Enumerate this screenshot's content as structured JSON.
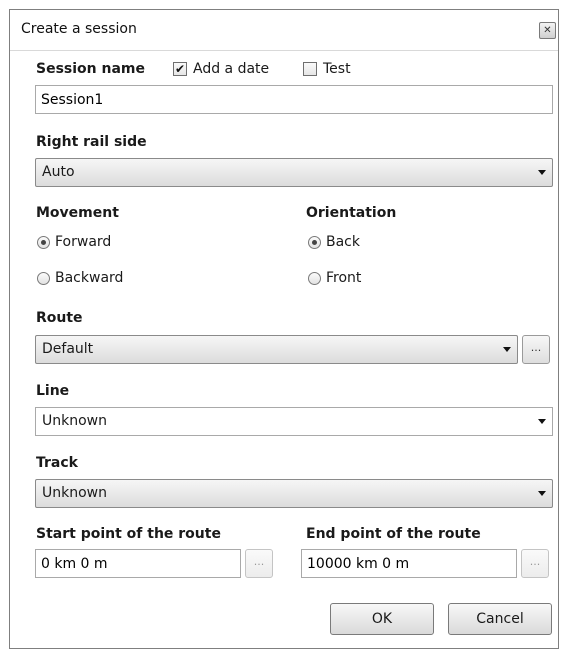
{
  "window": {
    "title": "Create a session",
    "close_glyph": "✕"
  },
  "session": {
    "label": "Session name",
    "add_date_label": "Add a date",
    "add_date_checked": true,
    "test_label": "Test",
    "test_checked": false,
    "name_value": "Session1"
  },
  "rail": {
    "label": "Right rail side",
    "value": "Auto"
  },
  "movement": {
    "label": "Movement",
    "forward": "Forward",
    "backward": "Backward",
    "selected": "Forward"
  },
  "orientation": {
    "label": "Orientation",
    "back": "Back",
    "front": "Front",
    "selected": "Back"
  },
  "route": {
    "label": "Route",
    "value": "Default",
    "browse": "..."
  },
  "line": {
    "label": "Line",
    "value": "Unknown"
  },
  "track": {
    "label": "Track",
    "value": "Unknown"
  },
  "start_point": {
    "label": "Start point of the route",
    "value": "0 km 0 m",
    "browse": "..."
  },
  "end_point": {
    "label": "End point of the route",
    "value": "10000 km 0 m",
    "browse": "..."
  },
  "buttons": {
    "ok": "OK",
    "cancel": "Cancel"
  }
}
